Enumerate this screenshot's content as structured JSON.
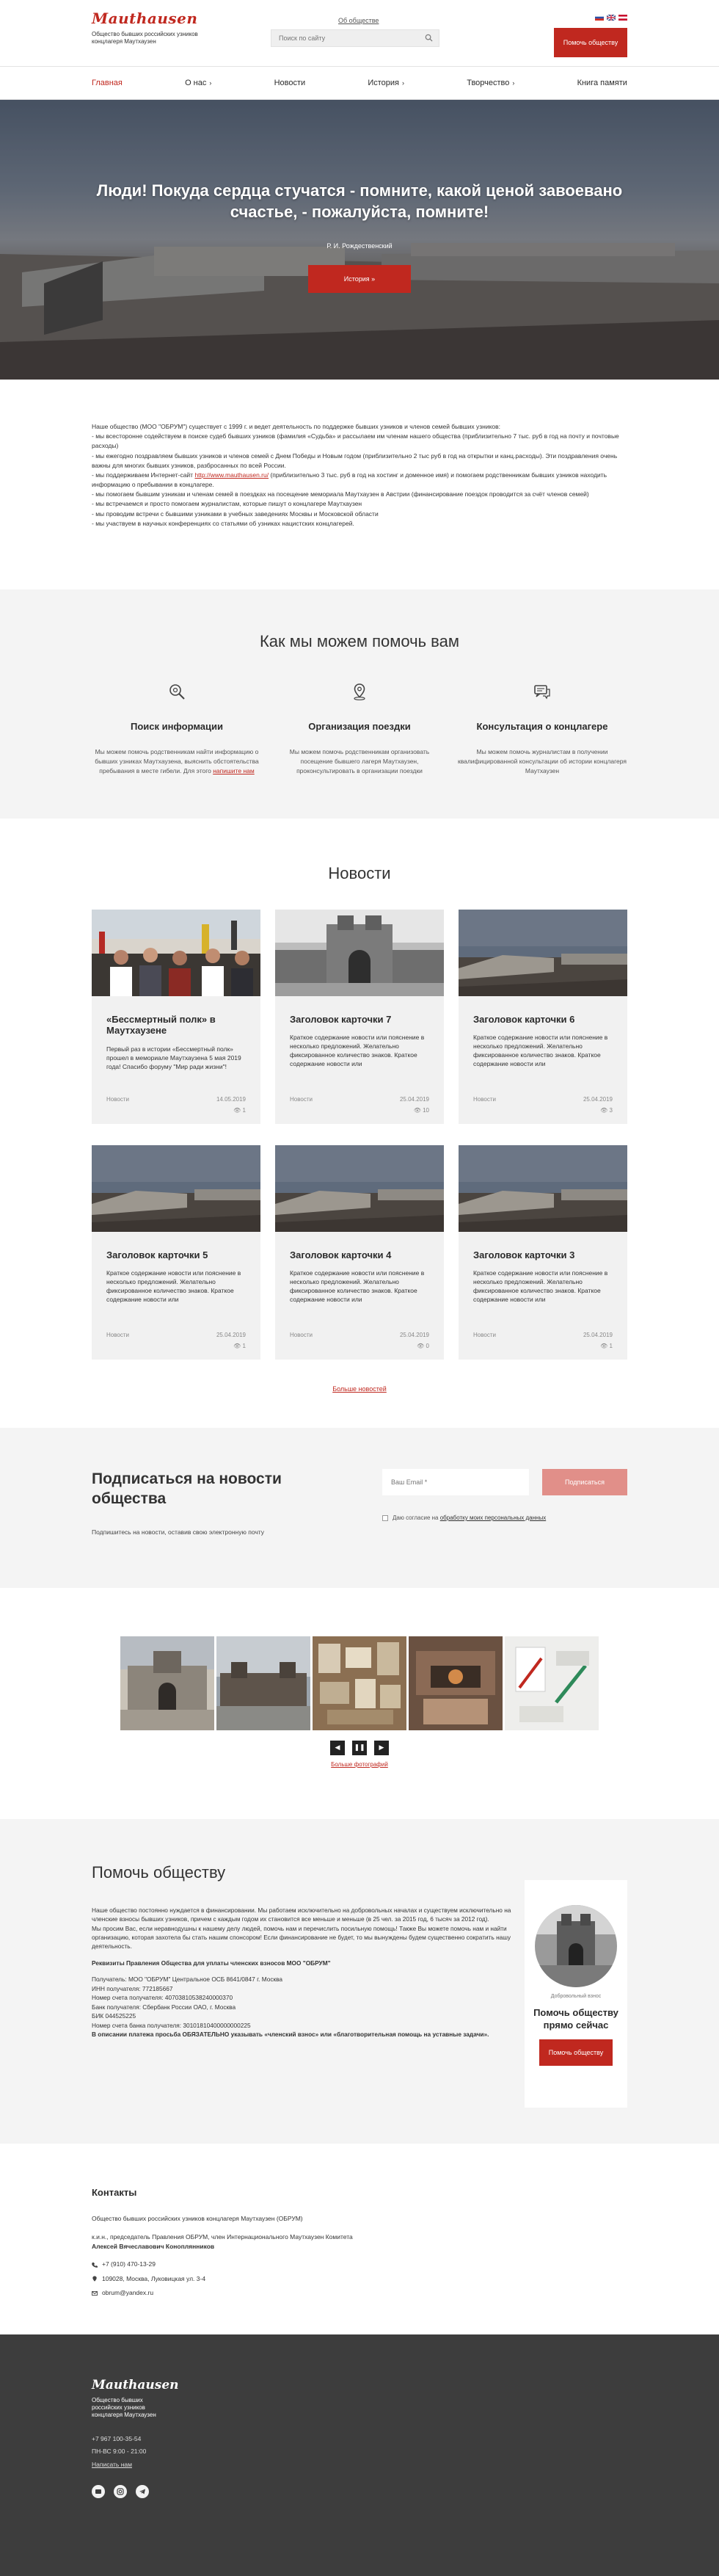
{
  "header": {
    "logo_text": "Mauthausen",
    "logo_subtitle": "Общество бывших российских узников концлагеря Маутхаузен",
    "about_link": "Об обществе",
    "search_placeholder": "Поиск по сайту",
    "help_button": "Помочь обществу",
    "languages": [
      "ru",
      "en",
      "de"
    ]
  },
  "nav": {
    "items": [
      {
        "label": "Главная",
        "chevron": ""
      },
      {
        "label": "О нас",
        "chevron": "›"
      },
      {
        "label": "Новости",
        "chevron": ""
      },
      {
        "label": "История",
        "chevron": "›"
      },
      {
        "label": "Творчество",
        "chevron": "›"
      },
      {
        "label": "Книга памяти",
        "chevron": ""
      }
    ]
  },
  "hero": {
    "title": "Люди! Покуда сердца стучатся - помните, какой ценой завоевано счастье, - пожалуйста, помните!",
    "author": "Р. И. Рождественский",
    "button": "История »"
  },
  "intro": {
    "p1": "Наше общество (МОО \"ОБРУМ\") существует с 1999 г. и ведет деятельность по поддержке бывших узников и членов семей бывших узников:",
    "p2": "- мы всесторонне содействуем в поиске судеб бывших узников (фамилия «Судьба» и рассылаем им членам нашего общества (приблизительно 7 тыс. руб в год на почту и почтовые расходы)",
    "p3": "- мы ежегодно поздравляем бывших узников и членов семей с Днем Победы и Новым годом (приблизительно 2 тыс руб в год на открытки и канц.расходы). Эти поздравления очень важны для многих бывших узников, разбросанных по всей России.",
    "p4a": "- мы поддерживаем Интернет-сайт ",
    "p4link": "http://www.mauthausen.ru/",
    "p4b": " (приблизительно 3 тыс. руб в год на хостинг и доменное имя) и помогаем родственникам бывших узников находить информацию о пребывании в концлагере.",
    "p5": "- мы помогаем бывшим узникам и членам семей в поездках на посещение мемориала Маутхаузен в Австрии (финансирование поездок проводится за счёт членов семей)",
    "p6": "- мы встречаемся и просто помогаем журналистам, которые пишут о концлагере Маутхаузен",
    "p7": "- мы проводим встречи с бывшими узниками в учебных заведениях Москвы и Московской области",
    "p8": "- мы участвуем в научных конференциях со статьями об узниках нацистских концлагерей."
  },
  "help": {
    "title": "Как мы можем помочь вам",
    "items": [
      {
        "title": "Поиск информации",
        "text": "Мы можем помочь родственникам найти информацию о бывших узниках Маутхаузена, выяснить обстоятельства пребывания в месте гибели. Для этого ",
        "link": "напишите нам"
      },
      {
        "title": "Организация поездки",
        "text": "Мы можем помочь родственникам организовать посещение бывшего лагеря Маутхаузен, проконсультировать в организации поездки",
        "link": ""
      },
      {
        "title": "Консультация о концлагере",
        "text": "Мы можем помочь журналистам в получении квалифицированной консультации об истории концлагеря Маутхаузен",
        "link": ""
      }
    ]
  },
  "news": {
    "title": "Новости",
    "more": "Больше новостей",
    "cards": [
      {
        "title": "«Бессмертный полк» в Маутхаузене",
        "text": "Первый раз в истории «Бессмертный полк» прошел в мемориале Маутхаузена 5 мая 2019 года! Спасибо форуму \"Мир ради жизни\"!",
        "category": "Новости",
        "date": "14.05.2019",
        "views": "1"
      },
      {
        "title": "Заголовок карточки 7",
        "text": "Краткое содержание новости или пояснение в несколько предложений. Желательно фиксированное количество знаков. Краткое содержание новости или",
        "category": "Новости",
        "date": "25.04.2019",
        "views": "10"
      },
      {
        "title": "Заголовок карточки 6",
        "text": "Краткое содержание новости или пояснение в несколько предложений. Желательно фиксированное количество знаков. Краткое содержание новости или",
        "category": "Новости",
        "date": "25.04.2019",
        "views": "3"
      },
      {
        "title": "Заголовок карточки 5",
        "text": "Краткое содержание новости или пояснение в несколько предложений. Желательно фиксированное количество знаков. Краткое содержание новости или",
        "category": "Новости",
        "date": "25.04.2019",
        "views": "1"
      },
      {
        "title": "Заголовок карточки 4",
        "text": "Краткое содержание новости или пояснение в несколько предложений. Желательно фиксированное количество знаков. Краткое содержание новости или",
        "category": "Новости",
        "date": "25.04.2019",
        "views": "0"
      },
      {
        "title": "Заголовок карточки 3",
        "text": "Краткое содержание новости или пояснение в несколько предложений. Желательно фиксированное количество знаков. Краткое содержание новости или",
        "category": "Новости",
        "date": "25.04.2019",
        "views": "1"
      }
    ]
  },
  "subscribe": {
    "title": "Подписаться на новости общества",
    "description": "Подпишитесь на новости, оставив свою электронную почту",
    "email_placeholder": "Ваш Email *",
    "button": "Подписаться",
    "consent_text": "Даю согласие на ",
    "consent_link": "обработку моих персональных данных"
  },
  "gallery": {
    "all_link": "Больше фотографий"
  },
  "donate": {
    "title": "Помочь обществу",
    "p1": "Наше общество постоянно нуждается в финансировании. Мы работаем исключительно на добровольных началах и существуем исключительно на членские взносы бывших узников, причем с каждым годом их становится все меньше и меньше (в 25 чел. за 2015 год, 6 тысяч за 2012 год).",
    "p2": "Мы просим Вас, если неравнодушны к нашему делу людей, помочь нам и перечислить посильную помощь! Также Вы можете помочь нам и найти организацию, которая захотела бы стать нашим спонсором! Если финансирование не будет, то мы вынуждены будем существенно сократить нашу деятельность.",
    "p3": "Реквизиты Правления Общества для уплаты членских взносов МОО \"ОБРУМ\"",
    "req1": "Получатель: МОО \"ОБРУМ\" Центральное ОСБ 8641/0847 г. Москва",
    "req2": "ИНН получателя: 772185667",
    "req3": "Номер счета получателя: 40703810538240000370",
    "req4": "Банк получателя: Сбербанк России ОАО, г. Москва",
    "req5": "БИК 044525225",
    "req6": "Номер счета банка получателя: 30101810400000000225",
    "note": "В описании платежа просьба ОБЯЗАТЕЛЬНО указывать «членский взнос» или «благотворительная помощь на уставные задачи».",
    "side_caption": "Добровольный взнос",
    "side_title": "Помочь обществу прямо сейчас",
    "side_button": "Помочь обществу"
  },
  "contacts": {
    "title": "Контакты",
    "org": "Общество бывших российских узников концлагеря Маутхаузен (ОБРУМ)",
    "rep_line": "к.и.н., председатель Правления ОБРУМ, член Интернационального Маутхаузен Комитета",
    "rep_name": "Алексей Вячеславович Коноплянников",
    "phone": "+7 (910) 470-13-29",
    "address": "109028, Москва, Луковицкая ул. 3-4",
    "email": "obrum@yandex.ru"
  },
  "footer": {
    "logo_text": "Mauthausen",
    "logo_subtitle": "Общество бывших российских узников концлагеря Маутхаузен",
    "phone": "+7 967 100-35-54",
    "hours": "ПН-ВС 9:00 - 21:00",
    "write_link": "Написать нам",
    "social": [
      "vk-icon",
      "instagram-icon",
      "telegram-icon"
    ]
  },
  "colors": {
    "accent": "#c0281f",
    "accent_light": "#e18f89",
    "section_gray": "#f4f4f4",
    "footer_bg": "#3d3d3d"
  }
}
